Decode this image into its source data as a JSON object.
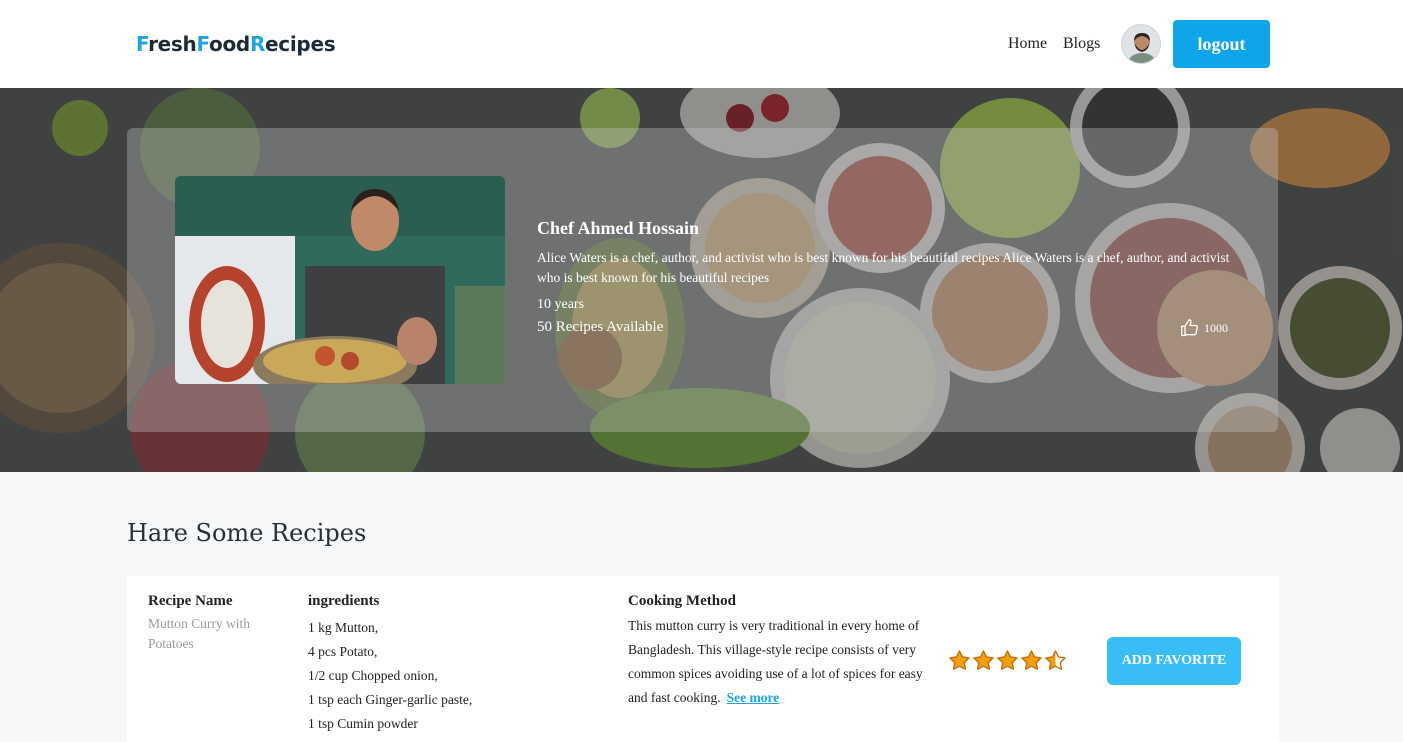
{
  "brand": {
    "parts": [
      "F",
      "resh",
      "F",
      "ood",
      "R",
      "ecipes"
    ]
  },
  "nav": {
    "home": "Home",
    "blogs": "Blogs",
    "logout": "logout"
  },
  "chef": {
    "name": "Chef Ahmed Hossain",
    "bio": "Alice Waters is a chef, author, and activist who is best known for his beautiful recipes Alice Waters is a chef, author, and activist who is best known for his beautiful recipes",
    "years": "10 years",
    "recipes": "50 Recipes Available",
    "likes": "1000"
  },
  "section": {
    "title": "Hare Some Recipes"
  },
  "recipe": {
    "name_head": "Recipe Name",
    "name": "Mutton Curry with Potatoes",
    "ingredients_head": "ingredients",
    "ingredients": [
      "1 kg Mutton,",
      "4 pcs Potato,",
      "1/2 cup Chopped onion,",
      "1 tsp each Ginger-garlic paste,",
      "1 tsp Cumin powder"
    ],
    "method_head": "Cooking Method",
    "method": "This mutton curry is very traditional in every home of Bangladesh. This village-style recipe consists of very common spices avoiding use of a lot of spices for easy and fast cooking.",
    "see_more": "See more",
    "rating": 4.5,
    "favorite_button": "ADD FAVORITE"
  },
  "colors": {
    "accent": "#1ea4e0",
    "button": "#0ea5e9",
    "favorite": "#38bdf8",
    "star": "#f59e0b"
  }
}
